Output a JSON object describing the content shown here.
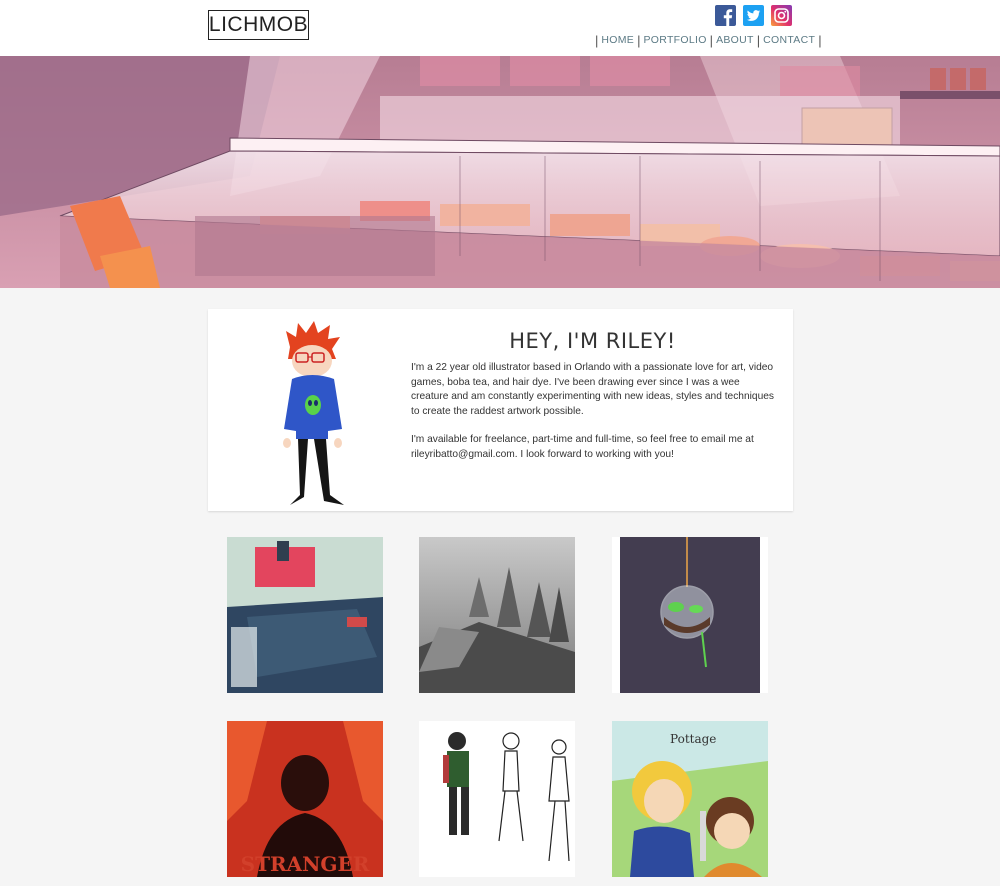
{
  "header": {
    "logo_text": "LICHMOB",
    "social": [
      {
        "name": "facebook",
        "icon": "facebook-icon",
        "color": "#3b5998"
      },
      {
        "name": "twitter",
        "icon": "twitter-icon",
        "color": "#1da1f2"
      },
      {
        "name": "instagram",
        "icon": "instagram-icon",
        "color": "#e1306c"
      }
    ],
    "nav": [
      "HOME",
      "PORTFOLIO",
      "ABOUT",
      "CONTACT"
    ]
  },
  "about": {
    "heading": "HEY, I'M RILEY!",
    "paragraph1": "I'm a 22 year old illustrator based in Orlando with a passionate love for art, video games, boba tea, and hair dye. I've been drawing ever since I was a wee creature and am constantly experimenting with new ideas, styles and techniques to create the raddest artwork possible.",
    "paragraph2": "I'm available for freelance, part-time and full-time, so feel free to email me at rileyribatto@gmail.com. I look forward to working with you!"
  },
  "gallery": {
    "tile4_title": "STRANGER",
    "tile6_caption": "Pottage"
  },
  "colors": {
    "accent_nav": "#5c7a85",
    "background": "#f5f5f5"
  }
}
